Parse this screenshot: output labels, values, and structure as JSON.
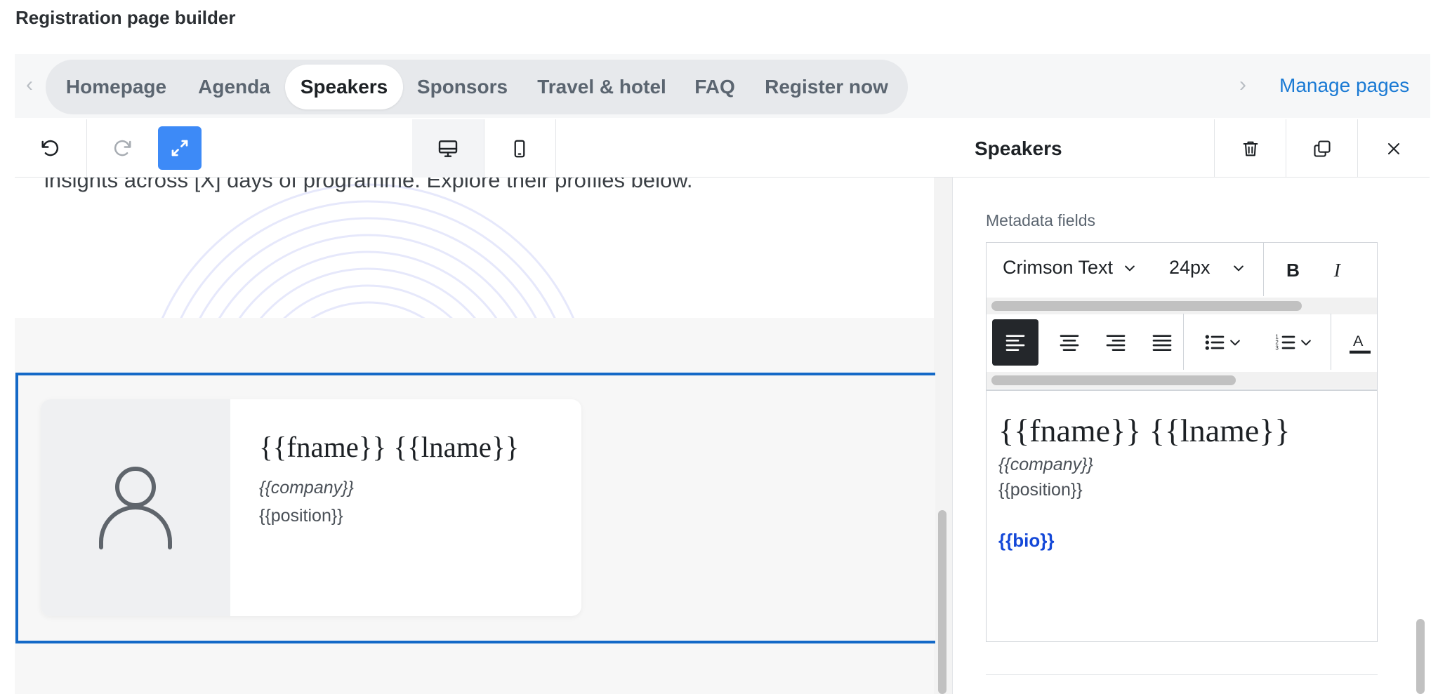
{
  "app": {
    "title": "Registration page builder"
  },
  "pages": {
    "tabs": [
      {
        "label": "Homepage",
        "active": false
      },
      {
        "label": "Agenda",
        "active": false
      },
      {
        "label": "Speakers",
        "active": true
      },
      {
        "label": "Sponsors",
        "active": false
      },
      {
        "label": "Travel & hotel",
        "active": false
      },
      {
        "label": "FAQ",
        "active": false
      },
      {
        "label": "Register now",
        "active": false
      }
    ],
    "manage_label": "Manage pages"
  },
  "toolbar": {
    "icons": [
      "undo-icon",
      "redo-icon",
      "expand-icon",
      "desktop-icon",
      "mobile-icon"
    ],
    "accent": "#3d8af7"
  },
  "canvas": {
    "hero_text": "insights across [X] days of programme. Explore their profiles below.",
    "speaker": {
      "name": "{{fname}} {{lname}}",
      "company": "{{company}}",
      "position": "{{position}}"
    },
    "selection_color": "#1469c7"
  },
  "panel": {
    "title": "Speakers",
    "icons": [
      "trash-icon",
      "duplicate-icon",
      "close-icon"
    ],
    "field_label": "Metadata fields",
    "editor": {
      "font_family": "Crimson Text",
      "font_size": "24px",
      "name": "{{fname}} {{lname}}",
      "company": "{{company}}",
      "position": "{{position}}",
      "bio": "{{bio}}",
      "bio_color": "#1448d8",
      "text_color_label": "A"
    }
  }
}
